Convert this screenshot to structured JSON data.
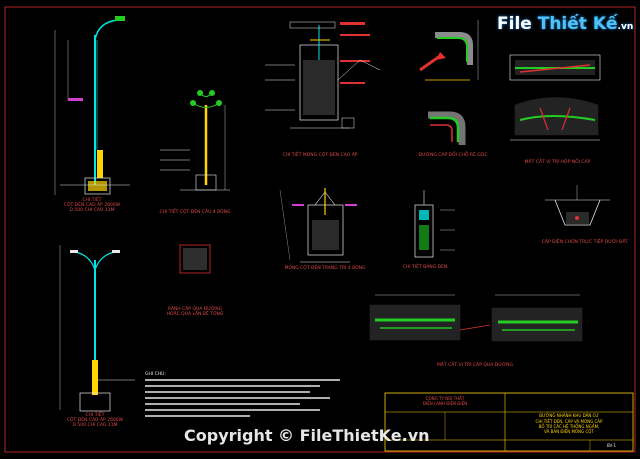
{
  "logo": {
    "part1": "File",
    "part2": "Thiết Kế",
    "domain": ".vn"
  },
  "watermark": "Copyright © FileThietKe.vn",
  "labels": {
    "pole_high_1": [
      "CHI TIẾT",
      "CỘT ĐÈN CAO ÁP 2600W",
      "D 500 CHI CAO 11M"
    ],
    "pole_lamp_4": [
      "CHI TIẾT CỘT ĐÈN CẦU 4 BÓNG"
    ],
    "pole_base": [
      "CHI TIẾT MÓNG CỘT ĐÈN CAO ÁP"
    ],
    "cable_bend": [
      "ĐƯỜNG CÁP ĐỔI CHỖ RẼ GÓC"
    ],
    "cable_cross": [
      "MẶT CẮT VỊ TRÍ HỘP NỐI CÁP"
    ],
    "base_4": [
      "MÓNG CỘT ĐÈN TRANG TRÍ 4 BÓNG"
    ],
    "lamp_detail": [
      "CHI TIẾT BẢNG ĐÈN"
    ],
    "cable_bury": [
      "CÁP ĐIỆN CHÔN TRỰC TIẾP DƯỚI ĐẤT"
    ],
    "trench_road": [
      "RÃNH CÁP QUA ĐƯỜNG",
      "HOẶC QUA LẤN BÊ TÔNG"
    ],
    "pole_high_2": [
      "CHI TIẾT",
      "CỘT ĐÈN CAO ÁP 2600W",
      "D 500 CHI CAO 11M"
    ],
    "cable_road": [
      "MẶT CẮT VỊ TRÍ CÁP QUA ĐƯỜNG"
    ],
    "notes_title": "GHI CHÚ:"
  },
  "title_block": {
    "company": [
      "CÔNG TY NỘI THẤT",
      "ĐIỆN LẠNH ĐIỆN ĐIỆN"
    ],
    "project_title": "ĐƯỜNG NHÁNH KHU DÂN CƯ",
    "drawing_title": [
      "CHI TIẾT ĐÈN, CÁP VÀ MÓNG CÁP",
      "BỐ TRÍ CÁC HỆ THỐNG NGẦM,",
      "VÀ BẢN ĐIỆN MÓNG CỘT"
    ],
    "sheet_no": "BV-1"
  },
  "colors": {
    "frame": "#e03030",
    "cyan": "#00e5e5",
    "yellow": "#ffd400",
    "green": "#22cc22",
    "red": "#e03030",
    "white": "#e8e8e8",
    "magenta": "#d040d0"
  }
}
